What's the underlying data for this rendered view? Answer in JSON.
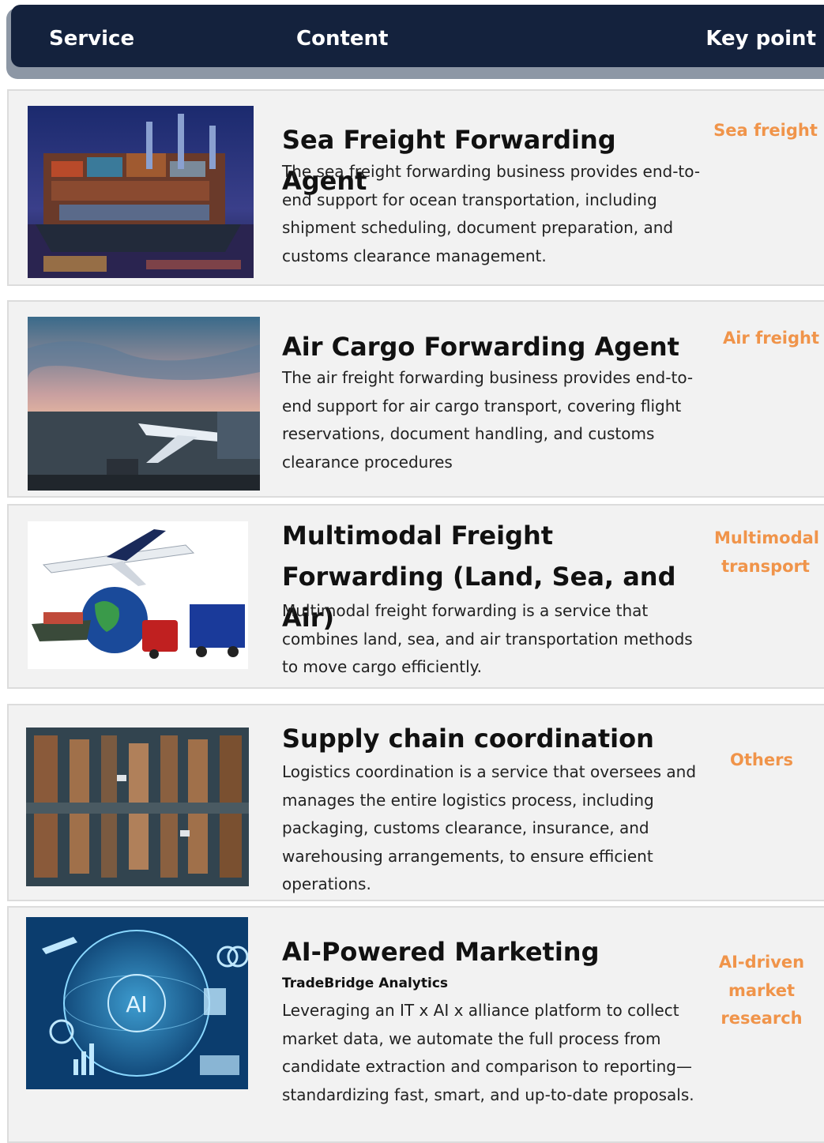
{
  "header": {
    "service": "Service",
    "content": "Content",
    "key_point": "Key point"
  },
  "services": [
    {
      "title": "Sea Freight Forwarding Agent",
      "description": "The sea freight forwarding business provides end-to-end support for ocean transportation, including shipment scheduling, document preparation, and customs clearance management.",
      "key_point": "Sea freight"
    },
    {
      "title": "Air Cargo Forwarding Agent",
      "description": "The air freight forwarding business provides end-to-end support for air cargo transport, covering flight reservations, document handling, and customs clearance procedures",
      "key_point": "Air freight"
    },
    {
      "title": "Multimodal Freight Forwarding (Land, Sea, and Air)",
      "description": "Multimodal freight forwarding is a service that combines land, sea, and air transportation methods to move cargo efficiently.",
      "key_point": "Multimodal transport"
    },
    {
      "title": "Supply chain coordination",
      "description": "Logistics coordination is a service that oversees and manages the entire logistics process, including packaging, customs clearance, insurance, and warehousing arrangements, to ensure efficient operations.",
      "key_point": "Others"
    },
    {
      "title": "AI-Powered Marketing",
      "subtitle": "TradeBridge Analytics",
      "description": "Leveraging an IT x AI x alliance platform to collect market data, we automate the full process from candidate extraction and comparison to reporting—standardizing fast, smart, and up-to-date proposals.",
      "key_point": "AI-driven market research",
      "image_text": "AI"
    }
  ],
  "colors": {
    "header_bg": "#14223d",
    "key_point": "#f0944a",
    "row_bg": "#f2f2f2"
  },
  "icons": [
    "container-ship-image",
    "airplane-at-gate-image",
    "multimodal-transport-image",
    "warehouse-aerial-image",
    "ai-globe-image"
  ]
}
